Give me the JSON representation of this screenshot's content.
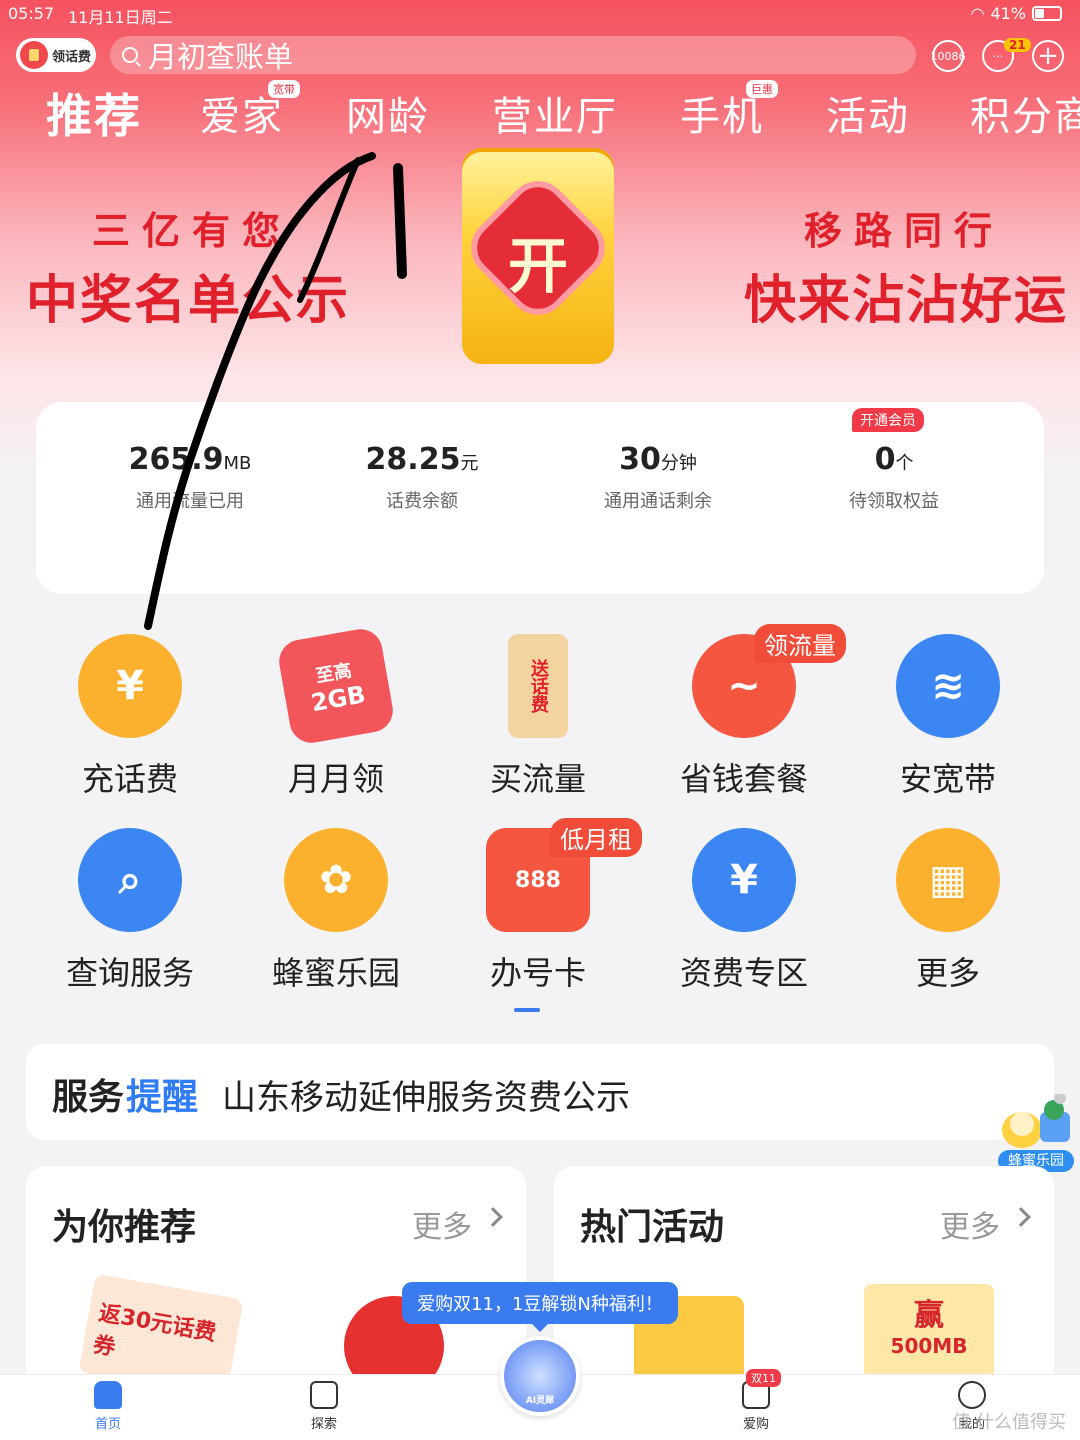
{
  "status": {
    "time": "05:57",
    "date": "11月11日周二",
    "battery": "41%"
  },
  "topbar": {
    "topup_label": "领话费",
    "search_placeholder": "月初查账单",
    "hotline": "10086",
    "message_count": "21"
  },
  "tabs": [
    {
      "label": "推荐",
      "active": true
    },
    {
      "label": "爱家",
      "badge": "宽带"
    },
    {
      "label": "网龄"
    },
    {
      "label": "营业厅"
    },
    {
      "label": "手机",
      "badge": "巨惠"
    },
    {
      "label": "活动"
    },
    {
      "label": "积分商"
    }
  ],
  "banner": {
    "left_line1": "三亿有您",
    "left_line2": "中奖名单公示",
    "right_line1": "移路同行",
    "right_line2": "快来沾沾好运",
    "card_text": "开"
  },
  "stats": [
    {
      "value": "265.9",
      "unit": "MB",
      "label": "通用流量已用"
    },
    {
      "value": "28.25",
      "unit": "元",
      "label": "话费余额"
    },
    {
      "value": "30",
      "unit": "分钟",
      "label": "通用通话剩余"
    },
    {
      "value": "0",
      "unit": "个",
      "label": "待领取权益"
    }
  ],
  "vip_tag": "开通会员",
  "services": [
    {
      "label": "充话费",
      "icon": "phone-yen-icon",
      "glyph": "¥",
      "color": "#fbb12d"
    },
    {
      "label": "月月领",
      "icon": "red-packet-icon",
      "glyph": "2GB",
      "color": "#f2555a",
      "tag_text": "至高"
    },
    {
      "label": "买流量",
      "icon": "gift-bag-icon",
      "glyph": "送话费",
      "color": "#f3d4a0"
    },
    {
      "label": "省钱套餐",
      "icon": "drop-chart-icon",
      "glyph": "~",
      "color": "#f4563f",
      "tag": "领流量"
    },
    {
      "label": "安宽带",
      "icon": "wifi-router-icon",
      "glyph": "≋",
      "color": "#3b86f3"
    },
    {
      "label": "查询服务",
      "icon": "search-card-icon",
      "glyph": "⌕",
      "color": "#3b86f3"
    },
    {
      "label": "蜂蜜乐园",
      "icon": "bee-icon",
      "glyph": "✿",
      "color": "#fbb12d"
    },
    {
      "label": "办号卡",
      "icon": "sim-card-icon",
      "glyph": "888",
      "color": "#f4563f",
      "tag": "低月租"
    },
    {
      "label": "资费专区",
      "icon": "clipboard-yen-icon",
      "glyph": "¥",
      "color": "#3b86f3"
    },
    {
      "label": "更多",
      "icon": "grid-more-icon",
      "glyph": "▦",
      "color": "#fbb12d"
    }
  ],
  "notice": {
    "title_a": "服务",
    "title_b": "提醒",
    "text": "山东移动延伸服务资费公示"
  },
  "panels": [
    {
      "title": "为你推荐",
      "more": "更多",
      "image_text": "返30元话费券"
    },
    {
      "title": "热门活动",
      "more": "更多",
      "image_text_a": "赢",
      "image_text_b": "500MB"
    }
  ],
  "promo_bubble": "爱购双11，1豆解锁N种福利！",
  "bee_float_label": "蜂蜜乐园",
  "nav": [
    {
      "label": "首页",
      "active": true
    },
    {
      "label": "探索"
    },
    {
      "label": "AI灵犀"
    },
    {
      "label": "爱购",
      "badge": "双11"
    },
    {
      "label": "我的"
    }
  ],
  "watermark": "值 什么值得买",
  "colors": {
    "brand_red": "#f0505d",
    "accent_blue": "#3b7bf0",
    "orange": "#fbb12d"
  }
}
